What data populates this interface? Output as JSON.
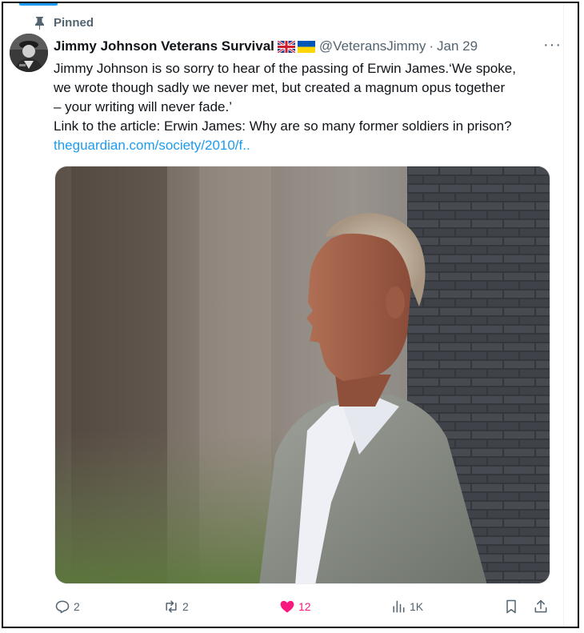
{
  "pinned_label": "Pinned",
  "author": {
    "name": "Jimmy Johnson Veterans Survival",
    "handle": "@VeteransJimmy",
    "date": "Jan 29",
    "flags": [
      "uk-flag-icon",
      "ukraine-flag-icon"
    ]
  },
  "tweet": {
    "line1": "Jimmy Johnson is so sorry to hear of the passing of Erwin James.‘We spoke,",
    "line2": "we wrote though sadly we never met, but created a magnum opus together",
    "line3": "– your writing will never fade.’",
    "line4": "Link to the article: Erwin James: Why are so many former soldiers in prison?",
    "link": "theguardian.com/society/2010/f.."
  },
  "more_label": "···",
  "actions": {
    "replies": "2",
    "retweets": "2",
    "likes": "12",
    "views": "1K"
  },
  "colors": {
    "accent": "#1d9bf0",
    "like": "#f91880",
    "muted": "#536471"
  }
}
